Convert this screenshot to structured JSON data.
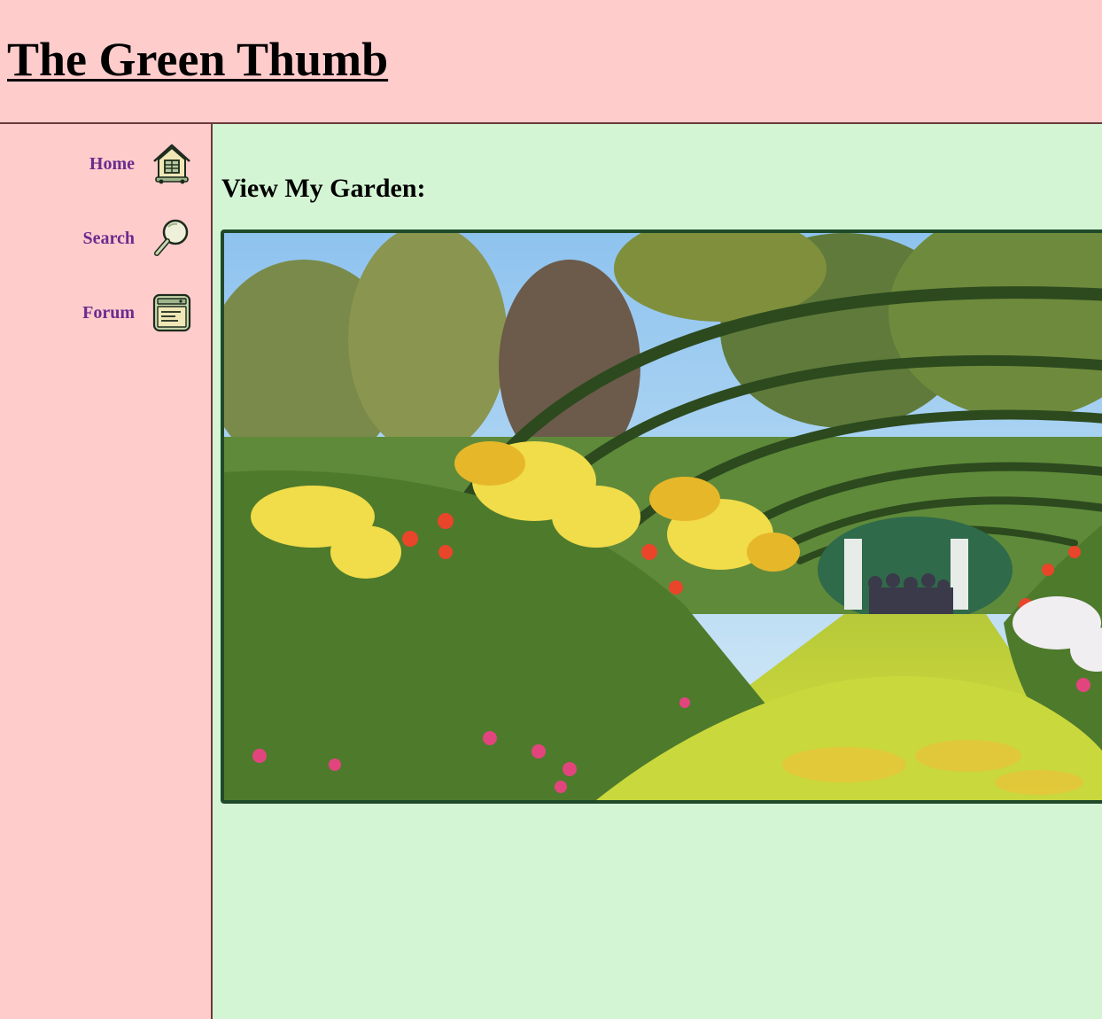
{
  "header": {
    "site_title": "The Green Thumb"
  },
  "nav": [
    {
      "label": "Home",
      "icon": "house-icon"
    },
    {
      "label": "Search",
      "icon": "magnifier-icon"
    },
    {
      "label": "Forum",
      "icon": "forum-icon"
    }
  ],
  "main": {
    "heading": "View My Garden:"
  },
  "colors": {
    "header_bg": "#ffcccc",
    "sidebar_bg": "#ffcccc",
    "main_bg": "#d4f5d4",
    "nav_text": "#6a2c8e",
    "frame_border": "#1f4a2a"
  }
}
